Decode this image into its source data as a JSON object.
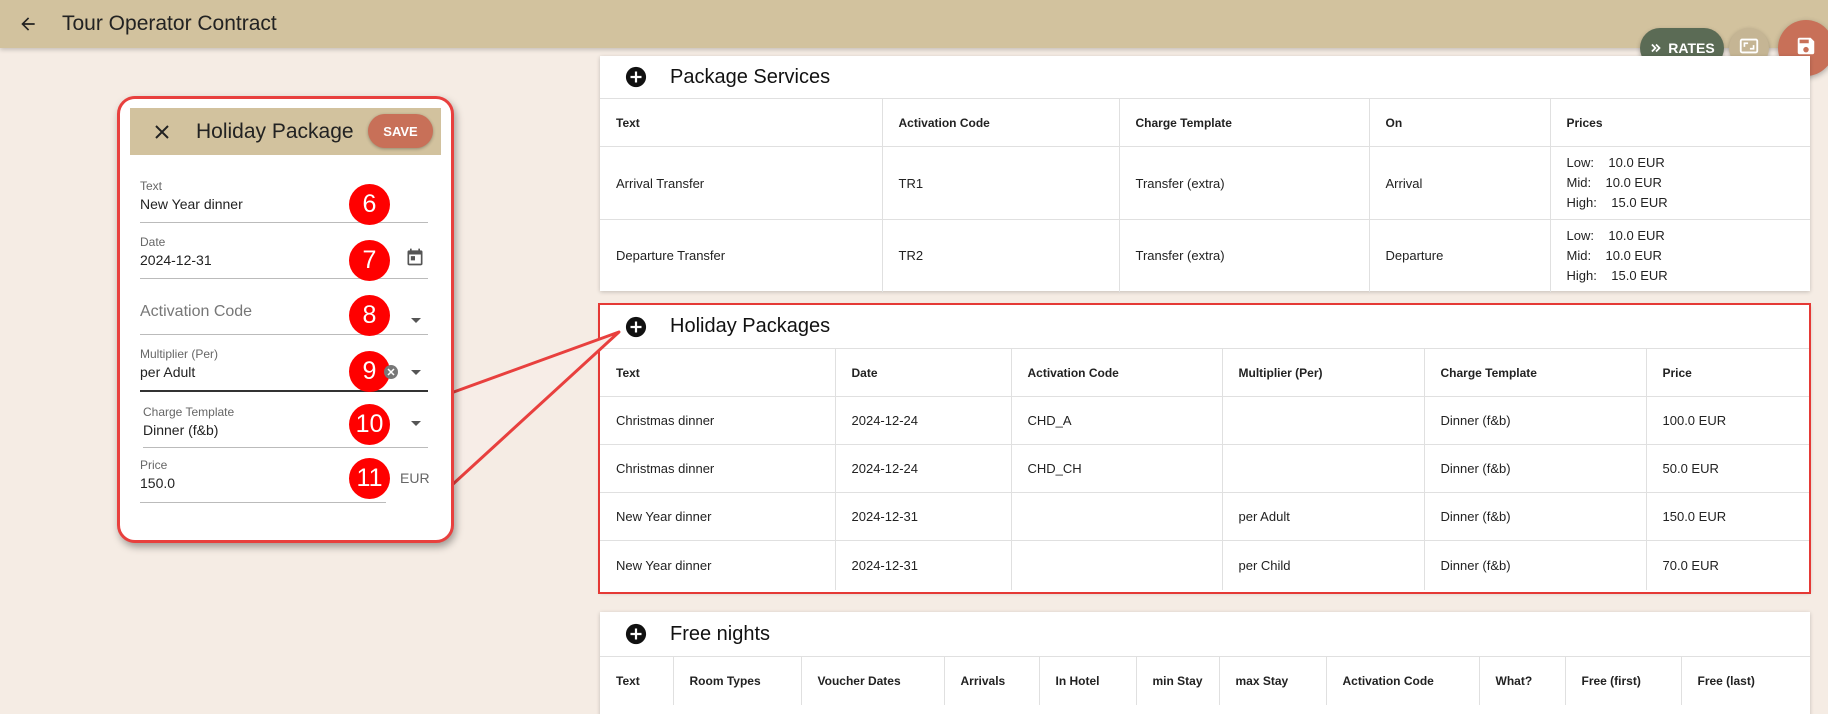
{
  "app": {
    "title": "Tour Operator Contract"
  },
  "fabs": {
    "rates_label": "RATES"
  },
  "package_services": {
    "title": "Package Services",
    "columns": [
      "Text",
      "Activation Code",
      "Charge Template",
      "On",
      "Prices"
    ],
    "rows": [
      {
        "text": "Arrival Transfer",
        "code": "TR1",
        "template": "Transfer (extra)",
        "on": "Arrival",
        "prices": [
          "Low:    10.0 EUR",
          "Mid:    10.0 EUR",
          "High:    15.0 EUR"
        ]
      },
      {
        "text": "Departure Transfer",
        "code": "TR2",
        "template": "Transfer (extra)",
        "on": "Departure",
        "prices": [
          "Low:    10.0 EUR",
          "Mid:    10.0 EUR",
          "High:    15.0 EUR"
        ]
      }
    ]
  },
  "holiday_packages": {
    "title": "Holiday Packages",
    "columns": [
      "Text",
      "Date",
      "Activation Code",
      "Multiplier (Per)",
      "Charge Template",
      "Price"
    ],
    "rows": [
      [
        "Christmas dinner",
        "2024-12-24",
        "CHD_A",
        "",
        "Dinner (f&b)",
        "100.0 EUR"
      ],
      [
        "Christmas dinner",
        "2024-12-24",
        "CHD_CH",
        "",
        "Dinner (f&b)",
        "50.0 EUR"
      ],
      [
        "New Year dinner",
        "2024-12-31",
        "",
        "per Adult",
        "Dinner (f&b)",
        "150.0 EUR"
      ],
      [
        "New Year dinner",
        "2024-12-31",
        "",
        "per Child",
        "Dinner (f&b)",
        "70.0 EUR"
      ]
    ]
  },
  "free_nights": {
    "title": "Free nights",
    "columns": [
      "Text",
      "Room Types",
      "Voucher Dates",
      "Arrivals",
      "In Hotel",
      "min Stay",
      "max Stay",
      "Activation Code",
      "What?",
      "Free (first)",
      "Free (last)"
    ]
  },
  "dialog": {
    "title": "Holiday Package",
    "save_label": "SAVE",
    "text_label": "Text",
    "text_value": "New Year dinner",
    "date_label": "Date",
    "date_value": "2024-12-31",
    "activation_placeholder": "Activation Code",
    "multiplier_label": "Multiplier (Per)",
    "multiplier_value": "per Adult",
    "charge_label": "Charge Template",
    "charge_value": "Dinner (f&b)",
    "price_label": "Price",
    "price_value": "150.0",
    "price_suffix": "EUR"
  },
  "annotations": [
    "6",
    "7",
    "8",
    "9",
    "10",
    "11"
  ],
  "colors": {
    "topbar": "#d2c29e",
    "accent": "#c87058",
    "rates": "#5b6b55",
    "highlight": "#e53935",
    "badge": "#ff0000"
  }
}
